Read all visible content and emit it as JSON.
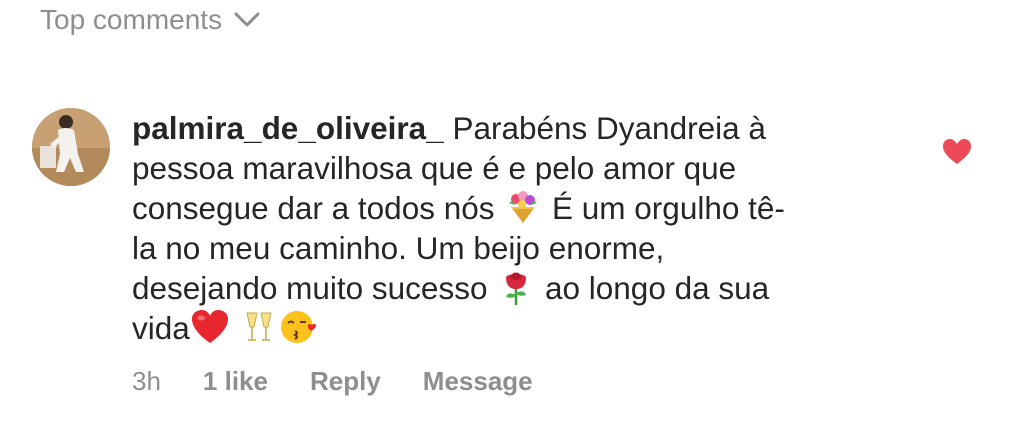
{
  "header": {
    "label": "Top comments",
    "icon": "chevron-down-icon"
  },
  "comment": {
    "username": "palmira_de_oliveira_",
    "text_lines": [
      " Parabéns Dyandreia à",
      "pessoa maravilhosa que é e pelo amor que",
      "consegue dar a todos nós ",
      "  É um orgulho tê-",
      "la no meu caminho. Um beijo enorme,",
      "desejando muito sucesso ",
      "  ao longo da sua",
      "vida",
      " "
    ],
    "emojis": [
      "bouquet-emoji",
      "rose-emoji",
      "red-heart-emoji",
      "clinking-glasses-emoji",
      "kissing-face-emoji"
    ],
    "time": "3h",
    "likes": "1 like",
    "reply_label": "Reply",
    "message_label": "Message",
    "liked": true,
    "heart_color": "#ed4956"
  }
}
